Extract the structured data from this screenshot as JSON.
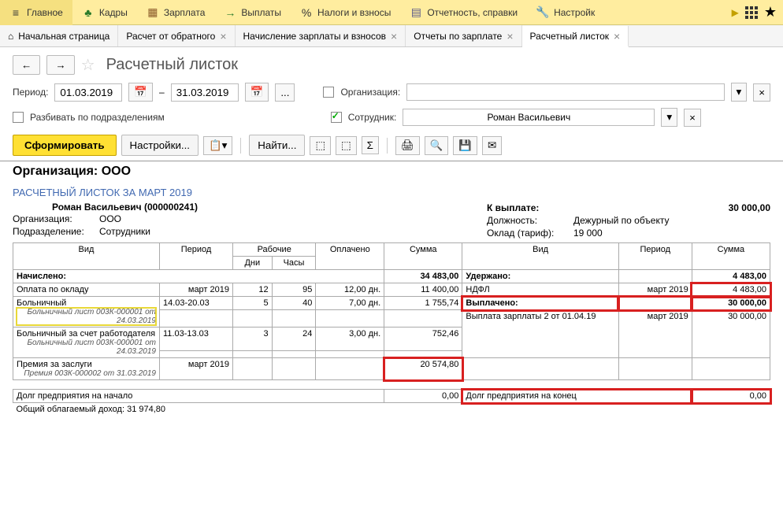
{
  "toolbar": {
    "items": [
      {
        "icon": "≡",
        "iconColor": "#333",
        "label": "Главное"
      },
      {
        "icon": "♣",
        "iconColor": "#2a7a2a",
        "label": "Кадры"
      },
      {
        "icon": "▦",
        "iconColor": "#8a5a2a",
        "label": "Зарплата"
      },
      {
        "icon": "→",
        "iconColor": "#2a7a2a",
        "label": "Выплаты"
      },
      {
        "icon": "%",
        "iconColor": "#333",
        "label": "Налоги и взносы"
      },
      {
        "icon": "▤",
        "iconColor": "#5a5a8a",
        "label": "Отчетность, справки"
      },
      {
        "icon": "🔧",
        "iconColor": "#333",
        "label": "Настройк"
      }
    ],
    "more": "▶",
    "star": "★"
  },
  "tabs": [
    {
      "icon": "⌂",
      "label": "Начальная страница",
      "closable": false
    },
    {
      "label": "Расчет от обратного",
      "closable": true
    },
    {
      "label": "Начисление зарплаты и взносов",
      "closable": true
    },
    {
      "label": "Отчеты по зарплате",
      "closable": true
    },
    {
      "label": "Расчетный листок",
      "closable": true,
      "active": true
    }
  ],
  "page_title": "Расчетный листок",
  "filters": {
    "period_label": "Период:",
    "date_from": "01.03.2019",
    "date_to": "31.03.2019",
    "dash": "–",
    "org_label": "Организация:",
    "split_label": "Разбивать по подразделениям",
    "emp_label": "Сотрудник:",
    "emp_value": "Роман Васильевич"
  },
  "actions": {
    "form": "Сформировать",
    "settings": "Настройки...",
    "find": "Найти..."
  },
  "report": {
    "org_title": "Организация: ООО",
    "section_title": "РАСЧЕТНЫЙ ЛИСТОК ЗА МАРТ 2019",
    "employee": "Роман Васильевич (000000241)",
    "org_lbl": "Организация:",
    "org_val": "ООО",
    "dept_lbl": "Подразделение:",
    "dept_val": "Сотрудники",
    "payout_lbl": "К выплате:",
    "payout_val": "30 000,00",
    "position_lbl": "Должность:",
    "position_val": "Дежурный по объекту",
    "salary_lbl": "Оклад (тариф):",
    "salary_val": "19 000",
    "headers": {
      "type": "Вид",
      "period": "Период",
      "work": "Рабочие",
      "days": "Дни",
      "hours": "Часы",
      "paid": "Оплачено",
      "sum": "Сумма",
      "type2": "Вид",
      "period2": "Период",
      "sum2": "Сумма"
    },
    "rows": {
      "accrued_lbl": "Начислено:",
      "accrued_sum": "34 483,00",
      "withheld_lbl": "Удержано:",
      "withheld_sum": "4 483,00",
      "salary_row": {
        "name": "Оплата по окладу",
        "period": "март 2019",
        "days": "12",
        "hours": "95",
        "paid": "12,00 дн.",
        "sum": "11 400,00"
      },
      "ndfl_row": {
        "name": "НДФЛ",
        "period": "март 2019",
        "sum": "4 483,00"
      },
      "sick_row": {
        "name": "Больничный",
        "period": "14.03-20.03",
        "days": "5",
        "hours": "40",
        "paid": "7,00 дн.",
        "sum": "1 755,74",
        "note": "Больничный лист 003К-000001 от 24.03.2019"
      },
      "paid_lbl": "Выплачено:",
      "paid_sum": "30 000,00",
      "sick_emp_row": {
        "name": "Больничный за счет работодателя",
        "period": "11.03-13.03",
        "days": "3",
        "hours": "24",
        "paid": "3,00 дн.",
        "sum": "752,46",
        "note": "Больничный лист 003К-000001 от 24.03.2019"
      },
      "payout_row": {
        "name": "Выплата зарплаты 2 от 01.04.19",
        "period": "март 2019",
        "sum": "30 000,00"
      },
      "bonus_row": {
        "name": "Премия за заслуги",
        "period": "март 2019",
        "sum": "20 574,80",
        "note": "Премия 003К-000002 от 31.03.2019"
      },
      "debt_start_lbl": "Долг предприятия на начало",
      "debt_start_val": "0,00",
      "debt_end_lbl": "Долг предприятия на конец",
      "debt_end_val": "0,00",
      "taxable_lbl": "Общий облагаемый доход: 31 974,80"
    }
  }
}
